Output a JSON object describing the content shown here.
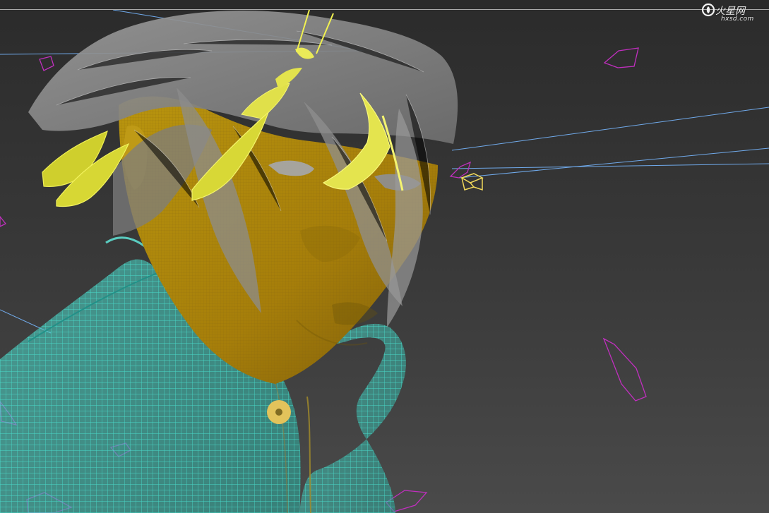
{
  "viewport": {
    "background_top": "#2b2b2b",
    "background_bottom": "#4a4a4a",
    "topbar_color": "#2a2a2a",
    "separator_color": "#a9a9a9"
  },
  "watermark": {
    "logo_text": "火星网",
    "url": "hxsd.com"
  },
  "scene": {
    "colors": {
      "hair": "#8f8f8f",
      "hair_highlight": "#c9c9c9",
      "skin": "#b08d12",
      "skin_shadow": "#8f6f0c",
      "jacket_wire": "#45e0cf",
      "jacket_dark": "#2ab7a7",
      "selected_strips": "#e1e12f",
      "light_lines": "#6fb6ff",
      "particles": "#c233c1",
      "button": "#e2c35b",
      "selection_box": "#e6d24b"
    },
    "icons": [
      "mesh-object",
      "hair-object",
      "light-line",
      "particle-shard",
      "selection-box"
    ]
  }
}
